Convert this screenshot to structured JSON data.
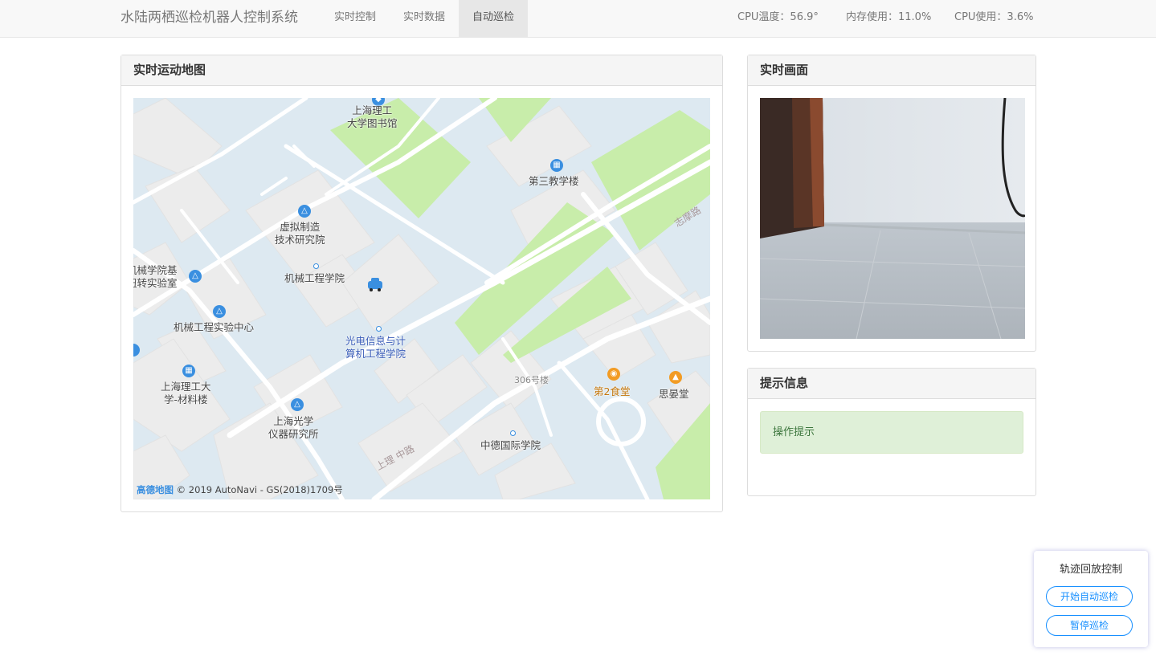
{
  "navbar": {
    "brand": "水陆两栖巡检机器人控制系统",
    "items": [
      {
        "label": "实时控制",
        "active": false
      },
      {
        "label": "实时数据",
        "active": false
      },
      {
        "label": "自动巡检",
        "active": true
      }
    ],
    "stats": {
      "cpu_temp": "CPU温度：56.9°",
      "memory": "内存使用：11.0%",
      "cpu_usage": "CPU使用：3.6%"
    }
  },
  "map_panel": {
    "title": "实时运动地图",
    "labels": {
      "library": "上海理工\n大学图书馆",
      "teaching3": "第三教学楼",
      "zhimo_road": "志摩路",
      "virtual_mfg": "虚拟制造\n技术研究院",
      "mech_eng": "机械工程学院",
      "mech_torsion": "机械学院基\n扭转实验室",
      "mech_lab": "机械工程实验中心",
      "optoelec": "光电信息与计\n算机工程学院",
      "materials": "上海理工大\n学-材料楼",
      "optics_inst": "上海光学\n仪器研究所",
      "building306": "306号楼",
      "canteen2": "第2食堂",
      "siyuan": "思晏堂",
      "sino_german": "中德国际学院",
      "shangli_road": "上理 中路"
    },
    "copyright_logo": "高德地图",
    "copyright": "© 2019 AutoNavi - GS(2018)1709号"
  },
  "camera_panel": {
    "title": "实时画面"
  },
  "info_panel": {
    "title": "提示信息",
    "message": "操作提示"
  },
  "replay": {
    "title": "轨迹回放控制",
    "start_label": "开始自动巡检",
    "pause_label": "暂停巡检"
  }
}
